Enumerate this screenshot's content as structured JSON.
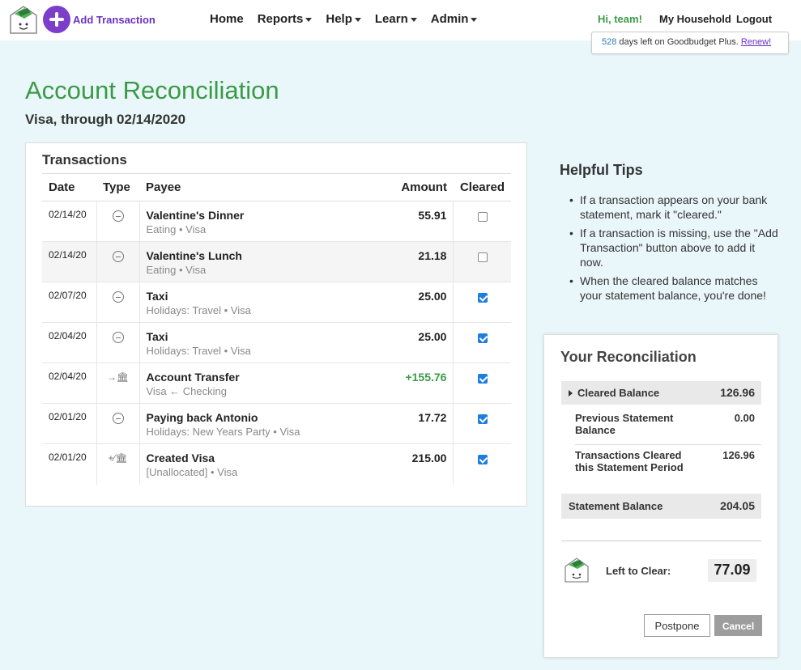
{
  "header": {
    "add_label": "Add Transaction",
    "nav": [
      {
        "label": "Home",
        "dropdown": false
      },
      {
        "label": "Reports",
        "dropdown": true
      },
      {
        "label": "Help",
        "dropdown": true
      },
      {
        "label": "Learn",
        "dropdown": true
      },
      {
        "label": "Admin",
        "dropdown": true
      }
    ],
    "greeting": "Hi, team!",
    "household": "My Household",
    "logout": "Logout",
    "plus_days": "528",
    "plus_text": " days left on Goodbudget Plus. ",
    "renew": "Renew!"
  },
  "page": {
    "title": "Account Reconciliation",
    "subtitle": "Visa, through 02/14/2020"
  },
  "transactions": {
    "heading": "Transactions",
    "columns": {
      "date": "Date",
      "type": "Type",
      "payee": "Payee",
      "amount": "Amount",
      "cleared": "Cleared"
    },
    "rows": [
      {
        "date": "02/14/20",
        "type": "minus-icon",
        "payee": "Valentine's Dinner",
        "detail": "Eating • Visa",
        "amount": "55.91",
        "positive": false,
        "cleared": false
      },
      {
        "date": "02/14/20",
        "type": "minus-icon",
        "payee": "Valentine's Lunch",
        "detail": "Eating • Visa",
        "amount": "21.18",
        "positive": false,
        "cleared": false
      },
      {
        "date": "02/07/20",
        "type": "minus-icon",
        "payee": "Taxi",
        "detail": "Holidays: Travel • Visa",
        "amount": "25.00",
        "positive": false,
        "cleared": true
      },
      {
        "date": "02/04/20",
        "type": "minus-icon",
        "payee": "Taxi",
        "detail": "Holidays: Travel • Visa",
        "amount": "25.00",
        "positive": false,
        "cleared": true
      },
      {
        "date": "02/04/20",
        "type": "transfer-icon",
        "payee": "Account Transfer",
        "detail": "Visa ← Checking",
        "amount": "+155.76",
        "positive": true,
        "cleared": true
      },
      {
        "date": "02/01/20",
        "type": "minus-icon",
        "payee": "Paying back Antonio",
        "detail": "Holidays: New Years Party • Visa",
        "amount": "17.72",
        "positive": false,
        "cleared": true
      },
      {
        "date": "02/01/20",
        "type": "new-account-icon",
        "payee": "Created Visa",
        "detail": "[Unallocated] • Visa",
        "amount": "215.00",
        "positive": false,
        "cleared": true
      }
    ]
  },
  "tips": {
    "title": "Helpful Tips",
    "items": [
      "If a transaction appears on your bank statement, mark it \"cleared.\"",
      "If a transaction is missing, use the \"Add Transaction\" button above to add it now.",
      "When the cleared balance matches your statement balance, you're done!"
    ]
  },
  "reconciliation": {
    "title": "Your Reconciliation",
    "cleared_label": "Cleared Balance",
    "cleared_value": "126.96",
    "prev_label": "Previous Statement Balance",
    "prev_value": "0.00",
    "txc_label": "Transactions Cleared this Statement Period",
    "txc_value": "126.96",
    "stmt_label": "Statement Balance",
    "stmt_value": "204.05",
    "ltc_label": "Left to Clear:",
    "ltc_value": "77.09",
    "postpone": "Postpone",
    "cancel": "Cancel"
  },
  "colors": {
    "brand_green": "#3c9a47",
    "accent_purple": "#7b3fc9",
    "checkbox_blue": "#1f7de0"
  }
}
